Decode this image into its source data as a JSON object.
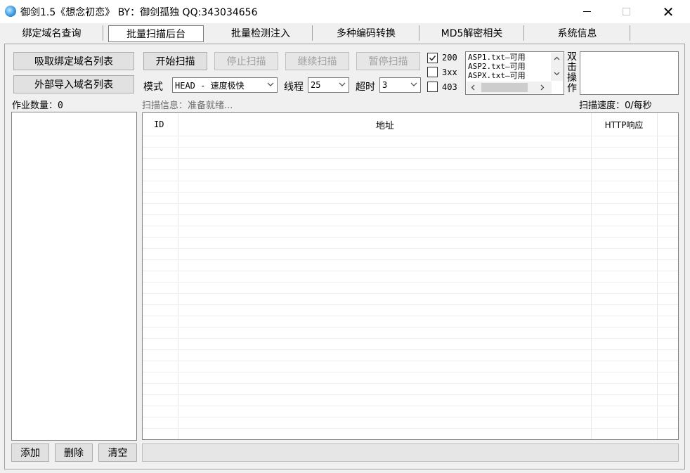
{
  "window": {
    "title": "御剑1.5《想念初恋》 BY：御剑孤独 QQ:343034656",
    "min_glyph": "",
    "close_glyph": "✕"
  },
  "tabs": [
    {
      "label": "绑定域名查询"
    },
    {
      "label": "批量扫描后台"
    },
    {
      "label": "批量检测注入"
    },
    {
      "label": "多种编码转换"
    },
    {
      "label": "MD5解密相关"
    },
    {
      "label": "系统信息"
    }
  ],
  "left": {
    "fetch_button": "吸取绑定域名列表",
    "import_button": "外部导入域名列表",
    "task_count_label": "作业数量：0",
    "add_button": "添加",
    "delete_button": "删除",
    "clear_button": "清空"
  },
  "scan": {
    "start": "开始扫描",
    "stop": "停止扫描",
    "resume": "继续扫描",
    "pause": "暂停扫描",
    "mode_label": "模式",
    "mode_value": "HEAD - 速度极快",
    "threads_label": "线程",
    "threads_value": "25",
    "timeout_label": "超时",
    "timeout_value": "3",
    "info": "扫描信息：准备就绪...",
    "speed": "扫描速度：0/每秒"
  },
  "status_filters": [
    {
      "label": "200",
      "checked": true
    },
    {
      "label": "3xx",
      "checked": false
    },
    {
      "label": "403",
      "checked": false
    }
  ],
  "dict_list": [
    "ASP1.txt—可用",
    "ASP2.txt—可用",
    "ASPX.txt—可用"
  ],
  "double_click_label": [
    "双",
    "击",
    "操",
    "作"
  ],
  "grid": {
    "columns": [
      "ID",
      "地址",
      "HTTP响应"
    ]
  },
  "colors": {
    "button_face": "#e1e1e1",
    "disabled_text": "#a0a0a0",
    "window_bg": "#f0f0f0"
  }
}
